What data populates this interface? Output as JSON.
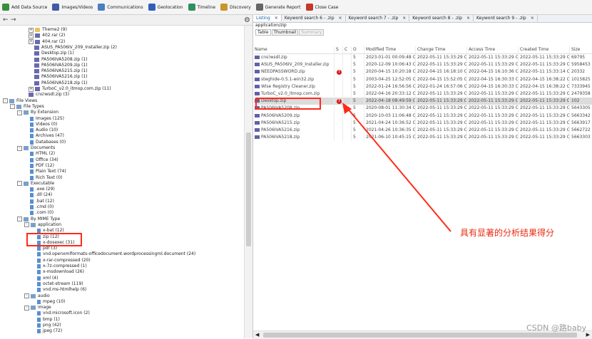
{
  "toolbar": {
    "buttons": [
      {
        "label": "Add Data Source",
        "color": "#3a8f3a"
      },
      {
        "label": "Images/Videos",
        "color": "#3f58a8"
      },
      {
        "label": "Communications",
        "color": "#4b7fc0"
      },
      {
        "label": "Geolocation",
        "color": "#2f5fb8"
      },
      {
        "label": "Timeline",
        "color": "#2f8f5f"
      },
      {
        "label": "Discovery",
        "color": "#c8962a"
      },
      {
        "label": "Generate Report",
        "color": "#666666"
      },
      {
        "label": "Close Case",
        "color": "#c23a2a"
      }
    ]
  },
  "tree": [
    {
      "label": "Theme2 (9)",
      "icon": "folder",
      "exp": "+"
    },
    {
      "label": "402.rar (2)",
      "icon": "zip",
      "exp": "+"
    },
    {
      "label": "404.rar (2)",
      "icon": "zip",
      "exp": "+"
    },
    {
      "label": "ASUS_PA506IV_209_Installer.zip (2)",
      "icon": "zip",
      "exp": ""
    },
    {
      "label": "Desktop.zip (1)",
      "icon": "zip",
      "exp": ""
    },
    {
      "label": "PA506IVA5208.zip (1)",
      "icon": "zip",
      "exp": ""
    },
    {
      "label": "PA506IVA5209.zip (1)",
      "icon": "zip",
      "exp": ""
    },
    {
      "label": "PA506IVA5215.zip (1)",
      "icon": "zip",
      "exp": ""
    },
    {
      "label": "PA506IVA5216.zip (1)",
      "icon": "zip",
      "exp": ""
    },
    {
      "label": "PA506IVA5218.zip (1)",
      "icon": "zip",
      "exp": ""
    },
    {
      "label": "TurboC_v2.0_itmop.com.zip (11)",
      "icon": "zip",
      "exp": "+"
    },
    {
      "label": "cns!wsdl.zip (3)",
      "icon": "zip",
      "exp": ""
    },
    {
      "label": "File Views",
      "icon": "node",
      "exp": "-"
    },
    {
      "label": "File Types",
      "icon": "node",
      "exp": "-"
    },
    {
      "label": "By Extension",
      "icon": "node",
      "exp": "-"
    },
    {
      "label": "Images (125)",
      "icon": "type",
      "exp": ""
    },
    {
      "label": "Videos (0)",
      "icon": "type",
      "exp": ""
    },
    {
      "label": "Audio (10)",
      "icon": "type",
      "exp": ""
    },
    {
      "label": "Archives (47)",
      "icon": "type",
      "exp": ""
    },
    {
      "label": "Databases (0)",
      "icon": "type",
      "exp": ""
    },
    {
      "label": "Documents",
      "icon": "node",
      "exp": "-"
    },
    {
      "label": "HTML (2)",
      "icon": "type",
      "exp": ""
    },
    {
      "label": "Office (34)",
      "icon": "type",
      "exp": ""
    },
    {
      "label": "PDF (12)",
      "icon": "type",
      "exp": ""
    },
    {
      "label": "Plain Text (74)",
      "icon": "type",
      "exp": ""
    },
    {
      "label": "Rich Text (0)",
      "icon": "type",
      "exp": ""
    },
    {
      "label": "Executable",
      "icon": "node",
      "exp": "-"
    },
    {
      "label": ".exe (29)",
      "icon": "type",
      "exp": ""
    },
    {
      "label": ".dll (24)",
      "icon": "type",
      "exp": ""
    },
    {
      "label": ".bat (12)",
      "icon": "type",
      "exp": ""
    },
    {
      "label": ".cmd (0)",
      "icon": "type",
      "exp": ""
    },
    {
      "label": ".com (0)",
      "icon": "type",
      "exp": ""
    },
    {
      "label": "By MIME Type",
      "icon": "node",
      "exp": "-"
    },
    {
      "label": "application",
      "icon": "node",
      "exp": "-"
    },
    {
      "label": "x-bat (12)",
      "icon": "type",
      "exp": ""
    },
    {
      "label": "zip (12)",
      "icon": "type",
      "exp": ""
    },
    {
      "label": "x-dosexec (31)",
      "icon": "type",
      "exp": ""
    },
    {
      "label": "pdf (3)",
      "icon": "type",
      "exp": ""
    },
    {
      "label": "vnd.openxmlformats-officedocument.wordprocessingml.document (24)",
      "icon": "type",
      "exp": ""
    },
    {
      "label": "x-rar-compressed (20)",
      "icon": "type",
      "exp": ""
    },
    {
      "label": "x-7z-compressed (1)",
      "icon": "type",
      "exp": ""
    },
    {
      "label": "x-msdownload (26)",
      "icon": "type",
      "exp": ""
    },
    {
      "label": "xml (4)",
      "icon": "type",
      "exp": ""
    },
    {
      "label": "octet-stream (119)",
      "icon": "type",
      "exp": ""
    },
    {
      "label": "vnd.ms-htmlhelp (6)",
      "icon": "type",
      "exp": ""
    },
    {
      "label": "audio",
      "icon": "node",
      "exp": "-"
    },
    {
      "label": "mpeg (10)",
      "icon": "type",
      "exp": ""
    },
    {
      "label": "image",
      "icon": "node",
      "exp": "-"
    },
    {
      "label": "vnd.microsoft.icon (2)",
      "icon": "type",
      "exp": ""
    },
    {
      "label": "bmp (1)",
      "icon": "type",
      "exp": ""
    },
    {
      "label": "png (42)",
      "icon": "type",
      "exp": ""
    },
    {
      "label": "jpeg (72)",
      "icon": "type",
      "exp": ""
    }
  ],
  "tabs": [
    {
      "label": "Listing",
      "active": true
    },
    {
      "label": "Keyword search 6 - .zip",
      "active": false
    },
    {
      "label": "Keyword search 7 - .zip",
      "active": false
    },
    {
      "label": "Keyword search 8 - .zip",
      "active": false
    },
    {
      "label": "Keyword search 9 - .zip",
      "active": false
    }
  ],
  "path": "application/zip",
  "subtabs": [
    {
      "label": "Table",
      "state": "active"
    },
    {
      "label": "Thumbnail",
      "state": "normal"
    },
    {
      "label": "Summary",
      "state": "disabled"
    }
  ],
  "columns": [
    "Name",
    "S",
    "C",
    "O",
    "Modified Time",
    "Change Time",
    "Access Time",
    "Created Time",
    "Size"
  ],
  "rows": [
    {
      "name": "cns!wsdl.zip",
      "s": "",
      "o": "5",
      "mod": "2023-01-01 00:09:48 CST",
      "chg": "2022-05-11 15:33:29 CST",
      "acc": "2022-05-11 15:33:29 CST",
      "cre": "2022-05-11 15:33:29 CST",
      "size": "69795",
      "sel": false
    },
    {
      "name": "ASUS_PA506IV_209_Installer.zip",
      "s": "",
      "o": "5",
      "mod": "2020-12-09 10:06:43 CST",
      "chg": "2022-05-11 15:33:29 CST",
      "acc": "2022-05-11 15:33:29 CST",
      "cre": "2022-05-11 15:33:29 CST",
      "size": "5958453",
      "sel": false
    },
    {
      "name": "NEEDPASSWORD.zip",
      "s": "!",
      "o": "5",
      "mod": "2020-04-15 10:20:18 CST",
      "chg": "2022-04-15 16:18:10 CST",
      "acc": "2022-04-15 16:10:36 CST",
      "cre": "2022-05-11 15:33:14 CST",
      "size": "20332",
      "sel": false
    },
    {
      "name": "steghide-0.5.1-win32.zip",
      "s": "",
      "o": "5",
      "mod": "2003-04-25 12:52:05 CST",
      "chg": "2022-04-15 15:52:05 CST",
      "acc": "2022-04-15 16:30:33 CST",
      "cre": "2022-04-15 16:38:22 CST",
      "size": "1015825",
      "sel": false
    },
    {
      "name": "Wise Registry Cleaner.zip",
      "s": "",
      "o": "5",
      "mod": "2022-01-24 16:56:56 CST",
      "chg": "2022-01-24 16:57:06 CST",
      "acc": "2022-04-15 16:30:33 CST",
      "cre": "2022-04-15 16:38:22 CST",
      "size": "7333945",
      "sel": false
    },
    {
      "name": "TurboC_v2.0_itmop.com.zip",
      "s": "",
      "o": "5",
      "mod": "2022-04-16 20:33:12 CST",
      "chg": "2022-05-11 15:33:29 CST",
      "acc": "2022-05-11 15:33:29 CST",
      "cre": "2022-05-11 15:33:29 CST",
      "size": "2479358",
      "sel": false
    },
    {
      "name": "Desktop.zip",
      "s": "!",
      "o": "5",
      "mod": "2022-04-18 08:49:59 CST",
      "chg": "2022-05-11 15:33:29 CST",
      "acc": "2022-05-11 15:33:29 CST",
      "cre": "2022-05-11 15:33:29 CST",
      "size": "102",
      "sel": true
    },
    {
      "name": "PA506IVA5208.zip",
      "s": "",
      "o": "5",
      "mod": "2020-08-01 11:30:34 CST",
      "chg": "2022-05-11 15:33:29 CST",
      "acc": "2022-05-11 15:33:29 CST",
      "cre": "2022-05-11 15:33:29 CST",
      "size": "5643305",
      "sel": false
    },
    {
      "name": "PA506IVA5209.zip",
      "s": "",
      "o": "5",
      "mod": "2020-10-03 11:06:48 CST",
      "chg": "2022-05-11 15:33:29 CST",
      "acc": "2022-05-11 15:33:29 CST",
      "cre": "2022-05-11 15:33:29 CST",
      "size": "5663342",
      "sel": false
    },
    {
      "name": "PA506IVA5215.zip",
      "s": "",
      "o": "5",
      "mod": "2021-04-24 10:36:52 CST",
      "chg": "2022-05-11 15:33:29 CST",
      "acc": "2022-05-11 15:33:29 CST",
      "cre": "2022-05-11 15:33:29 CST",
      "size": "5663917",
      "sel": false
    },
    {
      "name": "PA506IVA5216.zip",
      "s": "",
      "o": "5",
      "mod": "2021-04-26 10:36:35 CST",
      "chg": "2022-05-11 15:33:29 CST",
      "acc": "2022-05-11 15:33:29 CST",
      "cre": "2022-05-11 15:33:29 CST",
      "size": "5662722",
      "sel": false
    },
    {
      "name": "PA506IVA5218.zip",
      "s": "",
      "o": "5",
      "mod": "2021-06-10 10:45:15 CST",
      "chg": "2022-05-11 15:33:29 CST",
      "acc": "2022-05-11 15:33:29 CST",
      "cre": "2022-05-11 15:33:29 CST",
      "size": "5663303",
      "sel": false
    }
  ],
  "annotation": "具有显著的分析结果得分",
  "watermark": "CSDN @路baby",
  "colors": {
    "accent": "#ff2a1a",
    "warning": "#d81b1b"
  }
}
